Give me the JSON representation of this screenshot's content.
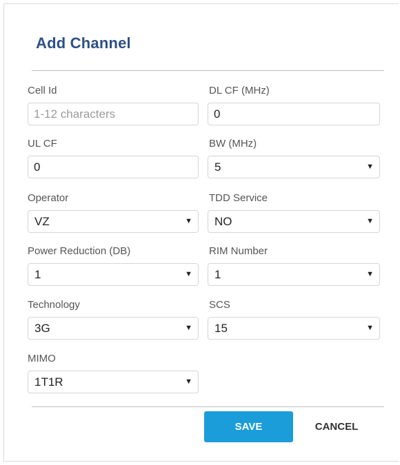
{
  "dialog": {
    "title": "Add Channel",
    "save_label": "SAVE",
    "cancel_label": "CANCEL"
  },
  "fields": {
    "cell_id": {
      "label": "Cell Id",
      "value": "",
      "placeholder": "1-12 characters"
    },
    "dl_cf": {
      "label": "DL CF (MHz)",
      "value": "0"
    },
    "ul_cf": {
      "label": "UL CF",
      "value": "0"
    },
    "bw": {
      "label": "BW (MHz)",
      "value": "5"
    },
    "operator": {
      "label": "Operator",
      "value": "VZ"
    },
    "tdd_service": {
      "label": "TDD Service",
      "value": "NO"
    },
    "power_reduction": {
      "label": "Power Reduction (DB)",
      "value": "1"
    },
    "rim_number": {
      "label": "RIM Number",
      "value": "1"
    },
    "technology": {
      "label": "Technology",
      "value": "3G"
    },
    "scs": {
      "label": "SCS",
      "value": "15"
    },
    "mimo": {
      "label": "MIMO",
      "value": "1T1R"
    }
  },
  "colors": {
    "title": "#2d4f86",
    "save_button": "#1a9dd9"
  },
  "icons": {
    "dropdown": "caret-down-icon"
  }
}
